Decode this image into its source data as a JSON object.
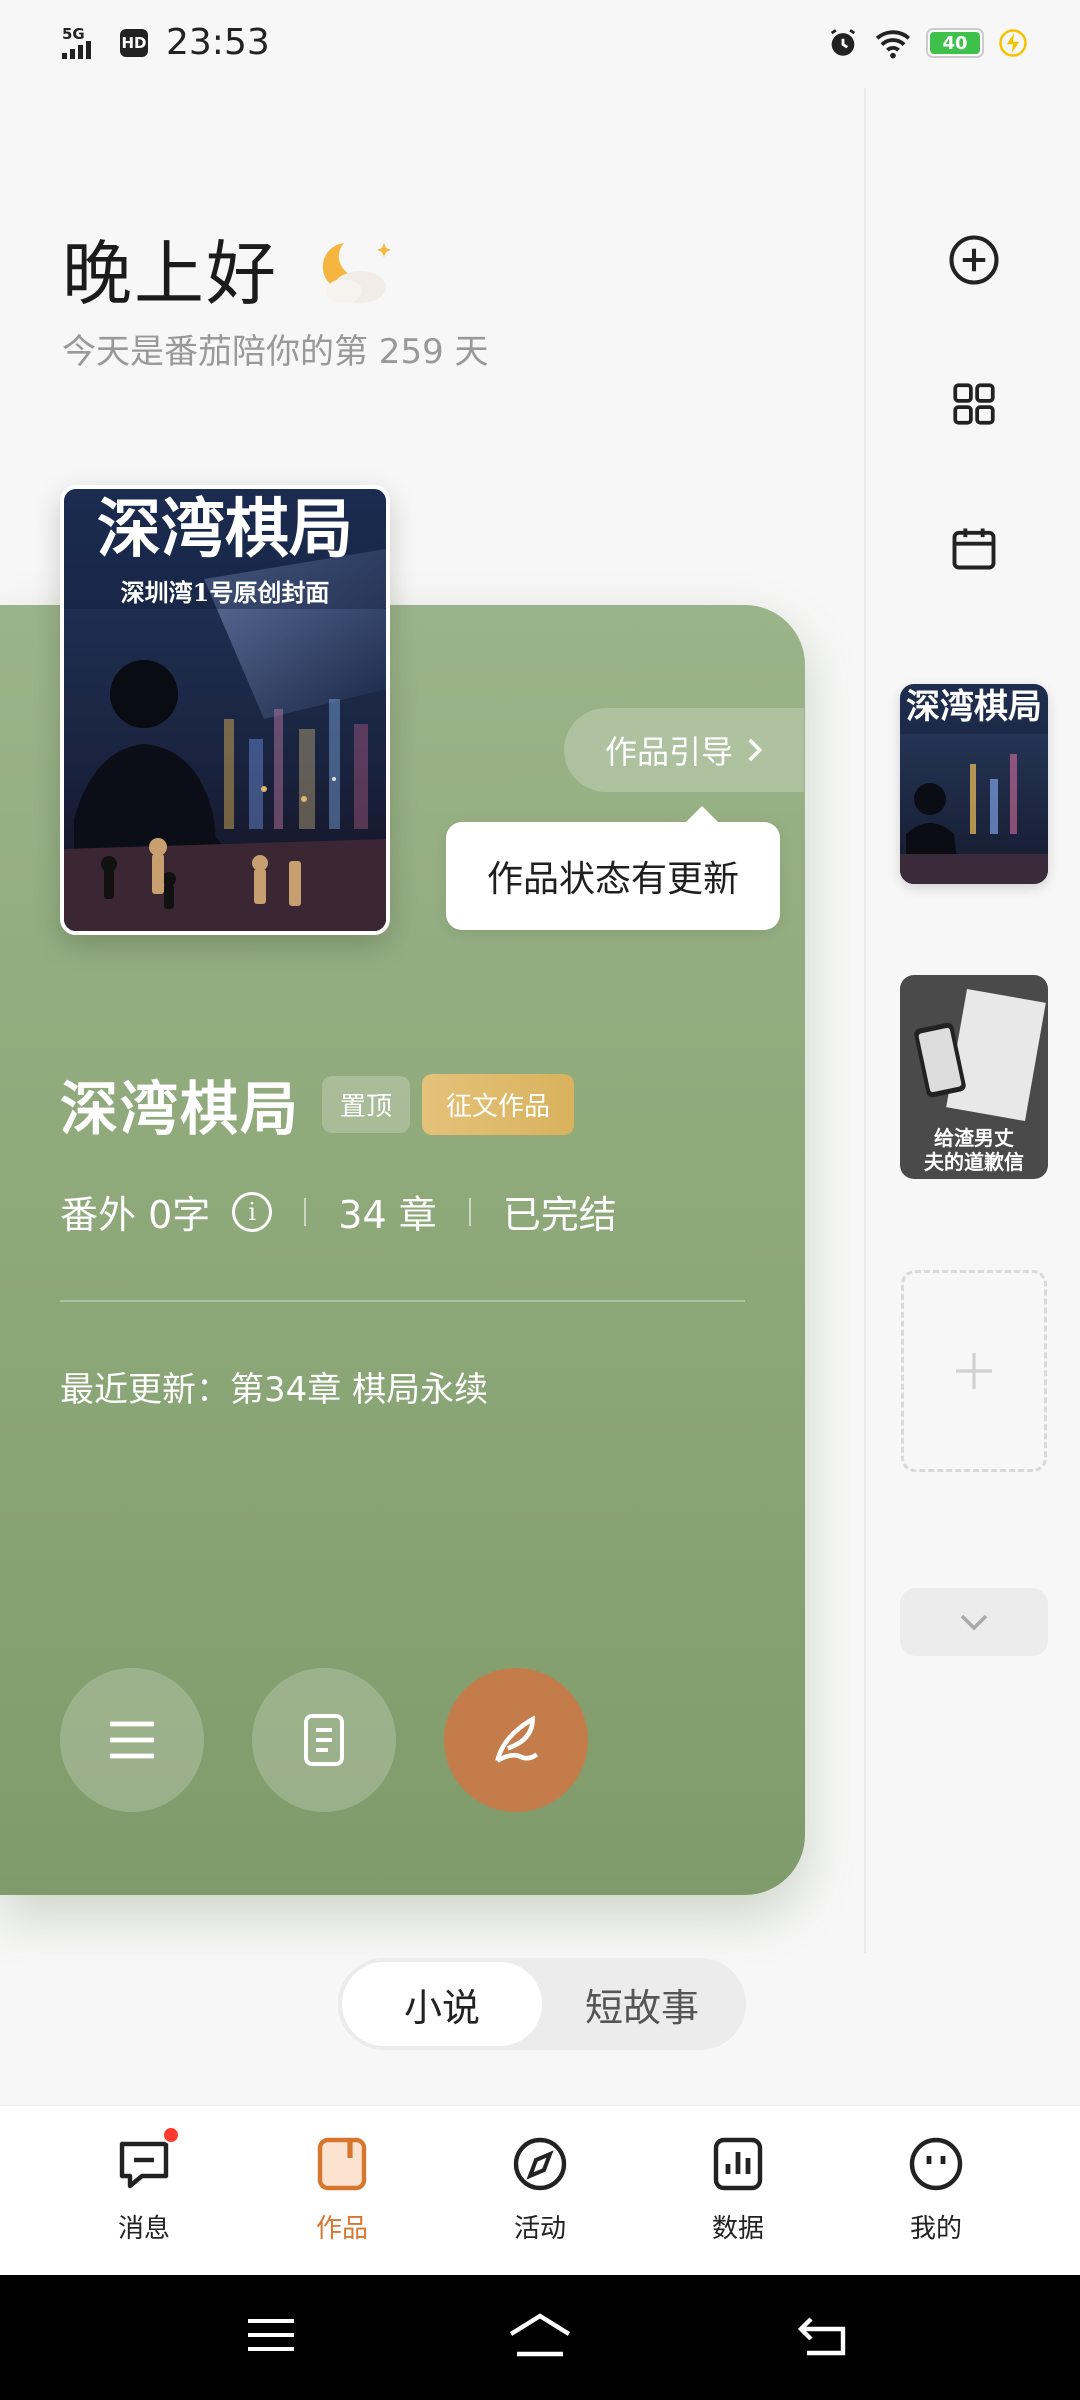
{
  "status_bar": {
    "network": "5G",
    "hd": "HD",
    "time": "23:53",
    "battery": "40"
  },
  "greeting": {
    "title": "晚上好",
    "subtitle": "今天是番茄陪你的第 259 天"
  },
  "work": {
    "guide_label": "作品引导",
    "tooltip": "作品状态有更新",
    "title": "深湾棋局",
    "badge_pinned": "置顶",
    "badge_contest": "征文作品",
    "extra": "番外 0字",
    "chapters": "34 章",
    "status": "已完结",
    "recent_label": "最近更新：",
    "recent_value": "第34章 棋局永续"
  },
  "covers": {
    "main_title": "深湾棋局",
    "main_subtitle": "深圳湾1号原创封面",
    "second_title_line1": "给渣男丈",
    "second_title_line2": "夫的道歉信"
  },
  "segment": {
    "items": [
      "小说",
      "短故事"
    ],
    "active": 0
  },
  "tabbar": {
    "items": [
      {
        "label": "消息",
        "icon": "message-icon"
      },
      {
        "label": "作品",
        "icon": "works-icon"
      },
      {
        "label": "活动",
        "icon": "compass-icon"
      },
      {
        "label": "数据",
        "icon": "chart-icon"
      },
      {
        "label": "我的",
        "icon": "profile-icon"
      }
    ],
    "active": 1
  },
  "colors": {
    "card_green": "#8fa97b",
    "accent_orange": "#d7772f",
    "write_button": "#c47c4a",
    "contest_badge": "#d8b25c",
    "notification": "#ff3b30"
  }
}
